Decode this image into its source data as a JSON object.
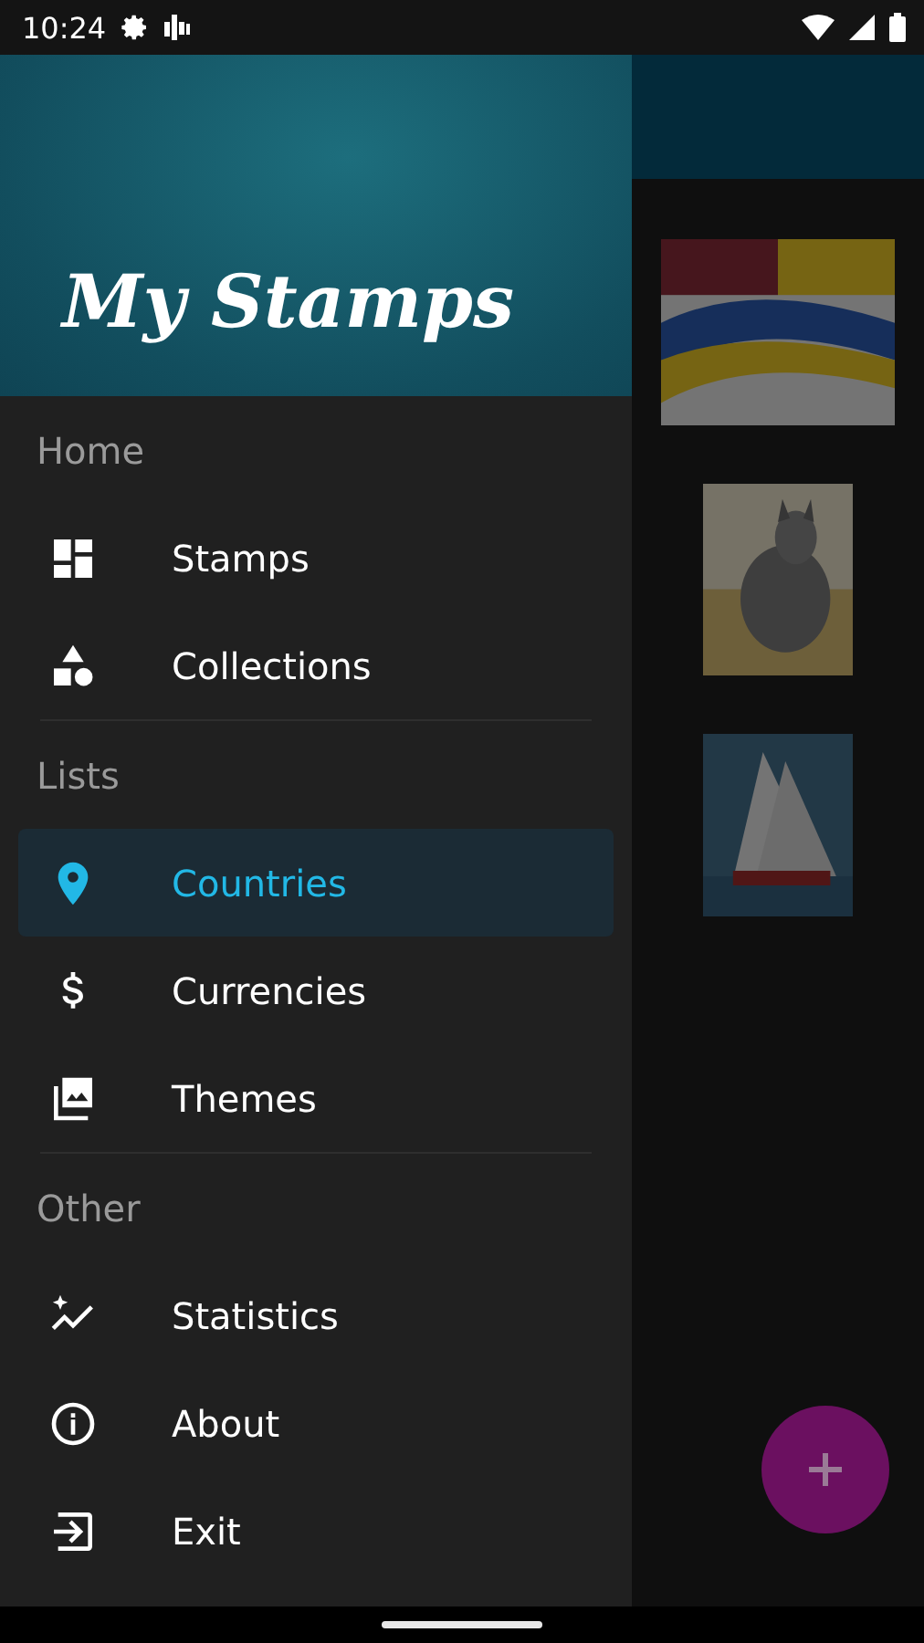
{
  "status_bar": {
    "time": "10:24"
  },
  "drawer": {
    "title": "My Stamps",
    "sections": [
      {
        "title": "Home",
        "items": [
          {
            "label": "Stamps",
            "selected": false
          },
          {
            "label": "Collections",
            "selected": false
          }
        ]
      },
      {
        "title": "Lists",
        "items": [
          {
            "label": "Countries",
            "selected": true
          },
          {
            "label": "Currencies",
            "selected": false
          },
          {
            "label": "Themes",
            "selected": false
          }
        ]
      },
      {
        "title": "Other",
        "items": [
          {
            "label": "Statistics",
            "selected": false
          },
          {
            "label": "About",
            "selected": false
          },
          {
            "label": "Exit",
            "selected": false
          }
        ]
      }
    ]
  }
}
